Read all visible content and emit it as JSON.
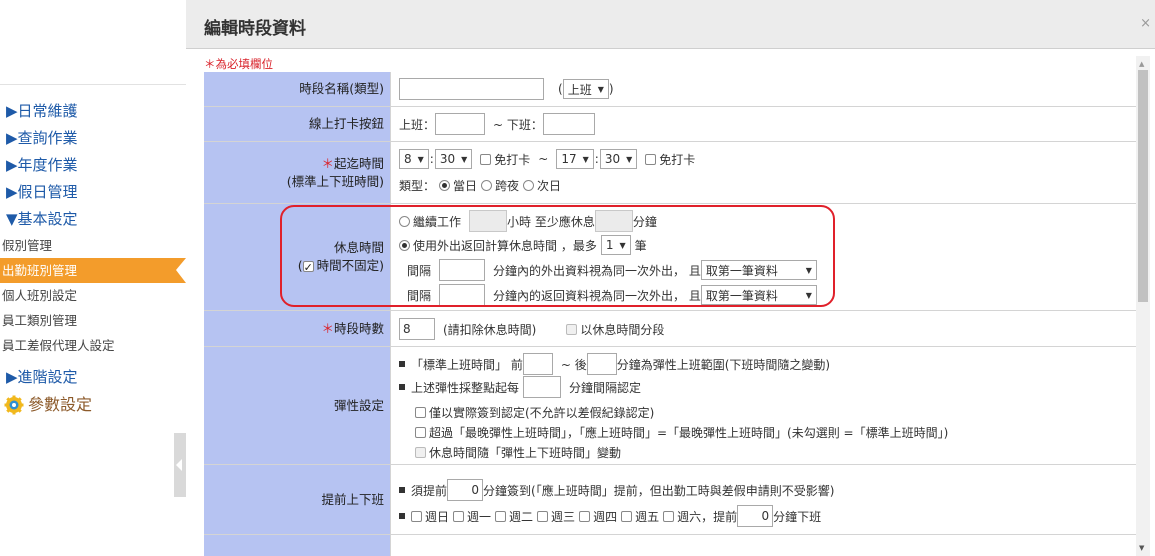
{
  "modal": {
    "title": "編輯時段資料",
    "close": "×",
    "required_note": "＊為必填欄位"
  },
  "menu": {
    "items": [
      "▶日常維護",
      "▶查詢作業",
      "▶年度作業",
      "▶假日管理",
      "▼基本設定"
    ],
    "subitems": [
      "假別管理",
      "出勤班別管理",
      "個人班別設定",
      "員工類別管理",
      "員工差假代理人設定"
    ],
    "advanced": "▶進階設定",
    "params": "參數設定"
  },
  "row_name": {
    "label": "時段名稱(類型)",
    "paren_open": "(",
    "type_value": "上班",
    "paren_close": ")"
  },
  "row_clock": {
    "label": "線上打卡按鈕",
    "on_label": "上班：",
    "tilde": "~ 下班："
  },
  "row_start": {
    "star": "＊",
    "label": "起迄時間",
    "label2": "(標準上下班時間)",
    "start_hour": "8",
    "start_min": "30",
    "no_punch": "免打卡",
    "tilde": "~",
    "end_hour": "17",
    "end_min": "30",
    "no_punch2": "免打卡",
    "type_label": "類型：",
    "opt_same": "當日",
    "opt_cross": "跨夜",
    "opt_next": "次日"
  },
  "row_break": {
    "label": "休息時間",
    "paren_open": "(",
    "fixed_label": "時間不固定)",
    "opt1_a": "繼續工作",
    "opt1_b": "小時 至少應休息",
    "opt1_c": "分鐘",
    "opt2_a": "使用外出返回計算休息時間 ，最多",
    "opt2_count": "1",
    "opt2_b": "筆",
    "interval": "間隔",
    "out_text": "分鐘內的外出資料視為同一次外出， 且",
    "out_select": "取第一筆資料",
    "interval2": "間隔",
    "ret_text": "分鐘內的返回資料視為同一次外出， 且",
    "ret_select": "取第一筆資料"
  },
  "row_hours": {
    "star": "＊",
    "label": "時段時數",
    "value": "8",
    "note": "(請扣除休息時間)",
    "split": "以休息時間分段"
  },
  "row_flex": {
    "label": "彈性設定",
    "line1_a": "「標準上班時間」 前",
    "line1_b": "~ 後",
    "line1_c": "分鐘為彈性上班範圍(下班時間隨之變動)",
    "line2_a": "上述彈性採整點起每",
    "line2_b": "分鐘間隔認定",
    "cb1": "僅以實際簽到認定(不允許以差假紀錄認定)",
    "cb2": "超過「最晚彈性上班時間」，「應上班時間」=「最晚彈性上班時間」(未勾選則 =「標準上班時間」)",
    "cb3": "休息時間隨「彈性上下班時間」變動"
  },
  "row_early": {
    "label": "提前上下班",
    "line1_a": "須提前",
    "line1_val": "0",
    "line1_b": "分鐘簽到(「應上班時間」提前，但出勤工時與差假申請則不受影響)",
    "days": [
      "週日",
      "週一",
      "週二",
      "週三",
      "週四",
      "週五",
      "週六"
    ],
    "line2_a": "，提前",
    "line2_val": "0",
    "line2_b": "分鐘下班"
  }
}
